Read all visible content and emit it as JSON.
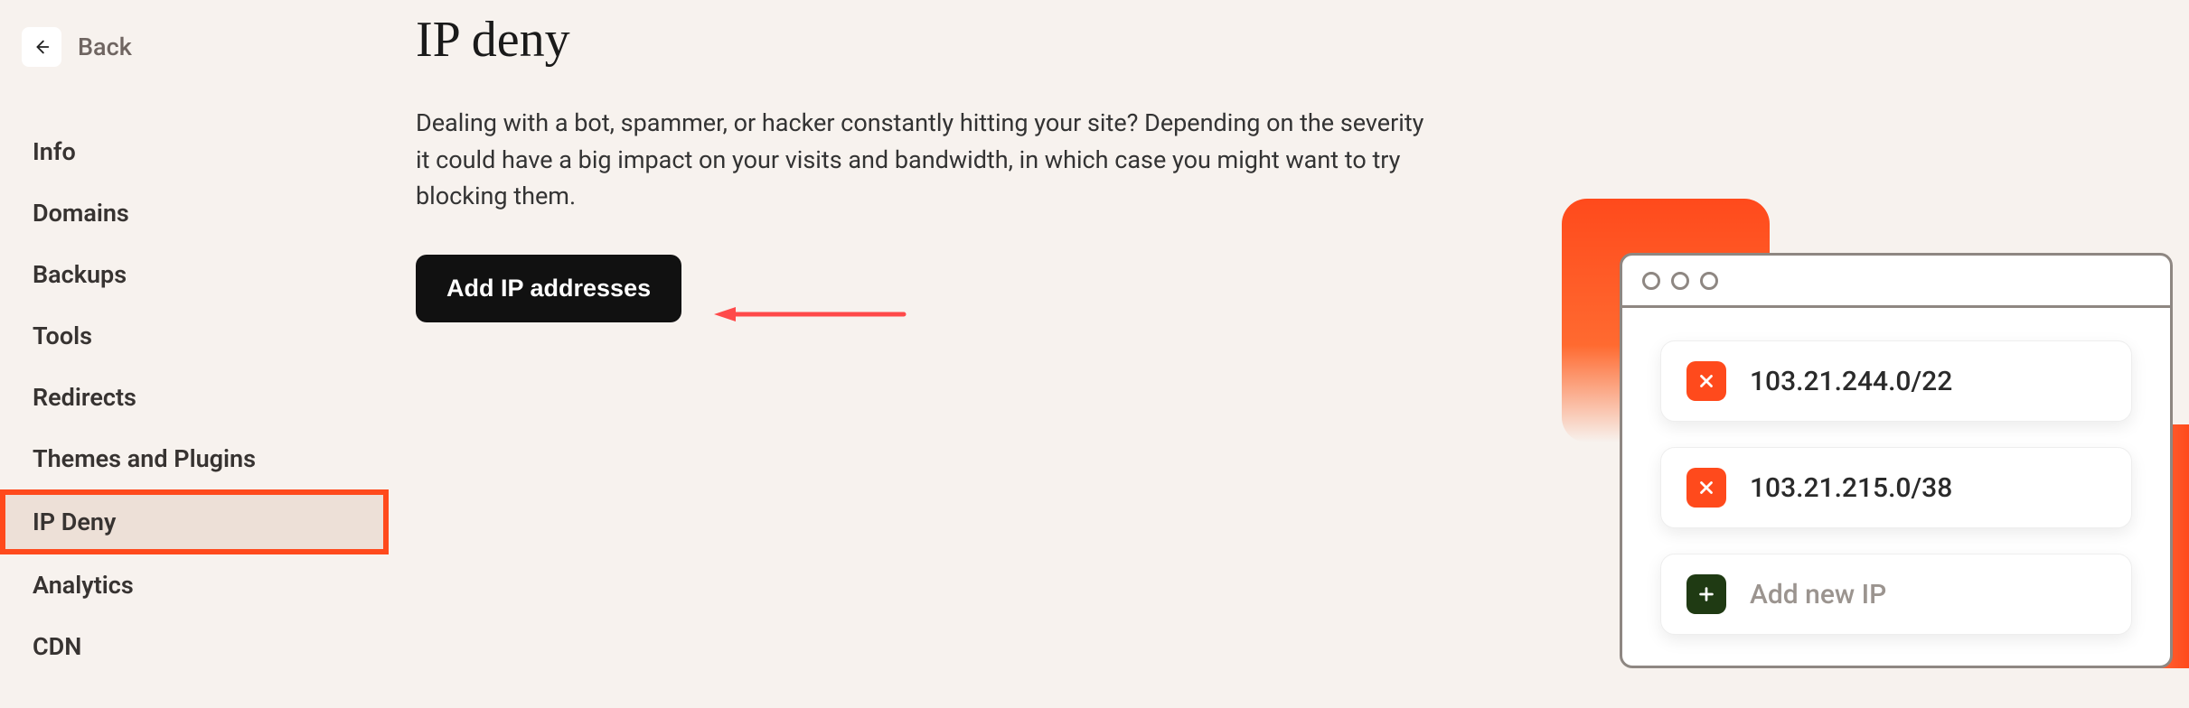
{
  "back": {
    "label": "Back"
  },
  "sidebar": {
    "items": [
      {
        "label": "Info",
        "slug": "info"
      },
      {
        "label": "Domains",
        "slug": "domains"
      },
      {
        "label": "Backups",
        "slug": "backups"
      },
      {
        "label": "Tools",
        "slug": "tools"
      },
      {
        "label": "Redirects",
        "slug": "redirects"
      },
      {
        "label": "Themes and Plugins",
        "slug": "themes-and-plugins"
      },
      {
        "label": "IP Deny",
        "slug": "ip-deny"
      },
      {
        "label": "Analytics",
        "slug": "analytics"
      },
      {
        "label": "CDN",
        "slug": "cdn"
      }
    ],
    "active_slug": "ip-deny"
  },
  "page": {
    "title": "IP deny",
    "description": "Dealing with a bot, spammer, or hacker constantly hitting your site? Depending on the severity it could have a big impact on your visits and bandwidth, in which case you might want to try blocking them.",
    "add_button_label": "Add IP addresses"
  },
  "illustration": {
    "ips": [
      "103.21.244.0/22",
      "103.21.215.0/38"
    ],
    "add_placeholder": "Add new IP"
  },
  "annotation": {
    "arrow_color": "#ff4a4a"
  }
}
